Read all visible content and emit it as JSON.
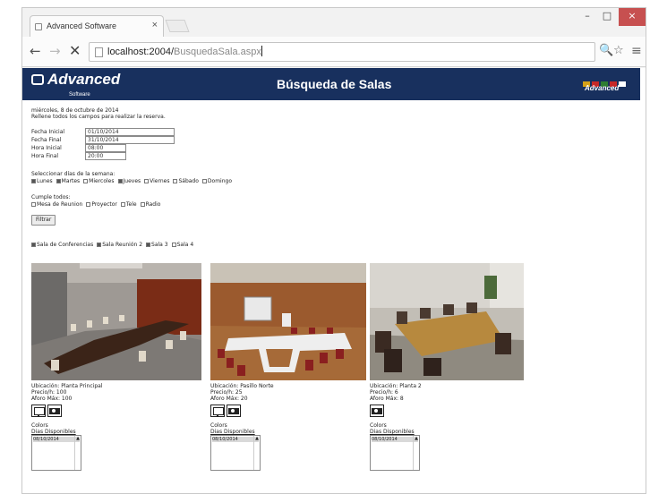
{
  "browser": {
    "tab_title": "Advanced Software",
    "tab_close": "×",
    "url_host": "localhost:2004/",
    "url_path": "BusquedaSala.aspx",
    "controls": {
      "minimize": "–",
      "maximize": "□",
      "close": "×"
    },
    "nav": {
      "back": "←",
      "forward": "→",
      "reload": "✕"
    },
    "toolbar_icons": {
      "zoom": "🔍",
      "star": "☆",
      "menu": "≡"
    }
  },
  "header": {
    "logo_text": "Advanced",
    "logo_sub": "Software",
    "title": "Búsqueda de Salas",
    "small_logo": "Advanced",
    "flag_colors": [
      "#d4a017",
      "#c62828",
      "#2e7d32",
      "#c62828",
      "#ffffff"
    ]
  },
  "intro": {
    "date_line": "miércoles, 8 de octubre de 2014",
    "instruction": "Rellene todos los campos para realizar la reserva."
  },
  "form": {
    "fecha_inicial_label": "Fecha Inicial",
    "fecha_inicial_value": "01/10/2014",
    "fecha_final_label": "Fecha Final",
    "fecha_final_value": "31/10/2014",
    "hora_inicial_label": "Hora Inicial",
    "hora_inicial_value": "08:00",
    "hora_final_label": "Hora Final",
    "hora_final_value": "20:00"
  },
  "days": {
    "label": "Seleccionar días de la semana:",
    "items": [
      {
        "label": "Lunes",
        "checked": true
      },
      {
        "label": "Martes",
        "checked": true
      },
      {
        "label": "Miercoles",
        "checked": false
      },
      {
        "label": "Jueves",
        "checked": true
      },
      {
        "label": "Viernes",
        "checked": false
      },
      {
        "label": "Sábado",
        "checked": false
      },
      {
        "label": "Domingo",
        "checked": false
      }
    ]
  },
  "equipment": {
    "label": "Cumple todos:",
    "items": [
      {
        "label": "Mesa de Reunion",
        "checked": false
      },
      {
        "label": "Proyector",
        "checked": false
      },
      {
        "label": "Tele",
        "checked": false
      },
      {
        "label": "Radio",
        "checked": false
      }
    ],
    "button_label": "Filtrar"
  },
  "rooms_filter": {
    "items": [
      {
        "label": "Sala de Conferencias",
        "checked": true
      },
      {
        "label": "Sala Reunión 2",
        "checked": true
      },
      {
        "label": "Sala 3",
        "checked": true
      },
      {
        "label": "Sala 4",
        "checked": false
      }
    ]
  },
  "rooms": [
    {
      "ubicacion": "Ubicación: Planta Principal",
      "precio": "Precio/h: 100",
      "aforo": "Aforo Máx: 100",
      "colors": "Colors",
      "dias": "Dias Disponibles",
      "list_first": "08/10/2014",
      "equip": [
        "screen",
        "projector"
      ]
    },
    {
      "ubicacion": "Ubicación: Pasillo Norte",
      "precio": "Precio/h: 25",
      "aforo": "Aforo Máx: 20",
      "colors": "Colors",
      "dias": "Dias Disponibles",
      "list_first": "08/10/2014",
      "equip": [
        "screen",
        "projector"
      ]
    },
    {
      "ubicacion": "Ubicación: Planta 2",
      "precio": "Precio/h: 6",
      "aforo": "Aforo Máx: 8",
      "colors": "Colors",
      "dias": "Dias Disponibles",
      "list_first": "08/10/2014",
      "equip": [
        "projector"
      ]
    }
  ]
}
